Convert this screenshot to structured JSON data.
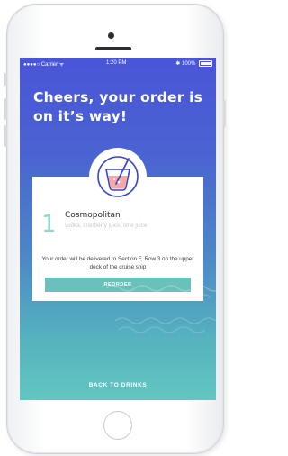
{
  "status_bar": {
    "carrier": "●●●●○ Carrier ᯤ",
    "time": "1:20 PM",
    "battery": "✱ 100%"
  },
  "confirmation": {
    "headline": "Cheers, your order is on it’s way!"
  },
  "order": {
    "quantity": "1",
    "drink_name": "Cosmopolitan",
    "ingredients": "vodka, cranberry juice, lime juice",
    "delivery_message": "Your order will be delivered to Section F, Row 3 on the upper deck of the cruise ship",
    "reorder_label": "REORDER"
  },
  "navigation": {
    "back_label": "BACK TO DRINKS"
  },
  "colors": {
    "gradient_top": "#4a55d8",
    "gradient_bottom": "#62c7c0",
    "accent": "#6ac1bb",
    "drink_pink": "#f4a7a3",
    "straw_blue": "#3a48c8"
  },
  "icons": {
    "drink": "cocktail-glass-icon",
    "decor": "wave-pattern-icon"
  }
}
